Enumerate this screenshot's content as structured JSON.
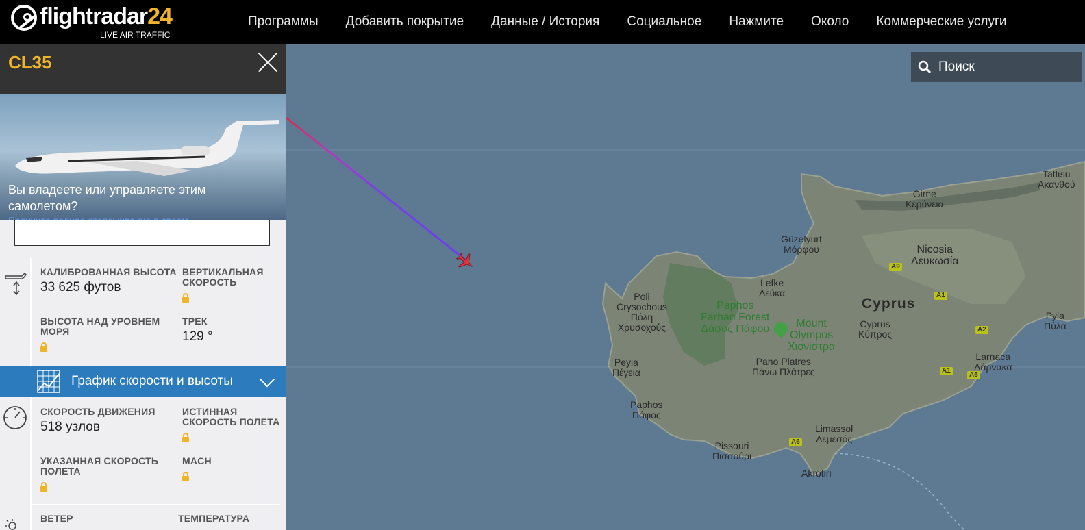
{
  "brand": {
    "name": "flightradar",
    "num": "24",
    "tagline": "LIVE AIR TRAFFIC"
  },
  "nav": [
    "Программы",
    "Добавить покрытие",
    "Данные / История",
    "Социальное",
    "Нажмите",
    "Около",
    "Коммерческие услуги"
  ],
  "search": {
    "placeholder": "Поиск"
  },
  "flight": {
    "callsign": "CL35",
    "photo_prompt": "Вы владеете или управляете этим самолетом?",
    "photo_sub": "Получите полное отслеживание в своем"
  },
  "altitude_section": {
    "cal_alt_label": "КАЛИБРОВАННАЯ ВЫСОТА",
    "cal_alt_value": "33 625 футов",
    "vs_label": "ВЕРТИКАЛЬНАЯ СКОРОСТЬ",
    "msl_label": "ВЫСОТА НАД УРОВНЕМ МОРЯ",
    "track_label": "ТРЕК",
    "track_value": "129 °"
  },
  "graph": {
    "label": "График скорости и высоты"
  },
  "speed_section": {
    "gs_label": "СКОРОСТЬ ДВИЖЕНИЯ",
    "gs_value": "518 узлов",
    "tas_label": "ИСТИННАЯ СКОРОСТЬ ПОЛЕТА",
    "ias_label": "УКАЗАННАЯ СКОРОСТЬ ПОЛЕТА",
    "mach_label": "MACH"
  },
  "weather_section": {
    "wind_label": "ВЕТЕР",
    "temp_label": "ТЕМПЕРАТУРА"
  },
  "map_labels": {
    "cyprus": "Cyprus",
    "girne": "Girne\nΚερύνεια",
    "tatlisu": "Tatlısu\nΑκανθού",
    "guzelyurt": "Güzelyurt\nΜόρφου",
    "nicosia": "Nicosia\nΛευκωσία",
    "lefke": "Lefke\nΛεύκα",
    "poli": "Poli\nCrysochous\nΠόλη\nΧρυσοχούς",
    "paphos_forest": "Paphos\nFarhan Forest\nΔάσος Πάφου",
    "olympos": "Mount\nOlympos\nΧιονίστρα",
    "cyprus_kypros": "Cyprus\nΚύπρος",
    "pyla": "Pyla\nΠύλα",
    "peyia": "Peyia\nΠέγεια",
    "pano_platres": "Pano Platres\nΠάνω Πλάτρες",
    "larnaca": "Larnaca\nΛάρνακα",
    "paphos": "Paphos\nΠάφος",
    "limassol": "Limassol\nΛεμεσός",
    "pissouri": "Pissouri\nΠισσούρι",
    "akrotiri": "Akrotiri"
  },
  "road_signs": [
    "A9",
    "A1",
    "A2",
    "A1",
    "A5",
    "A6"
  ],
  "colors": {
    "accent": "#f0b429",
    "sea": "#5e7a93",
    "panel_bar": "#2b7bbd",
    "land": "#7f8a78"
  }
}
